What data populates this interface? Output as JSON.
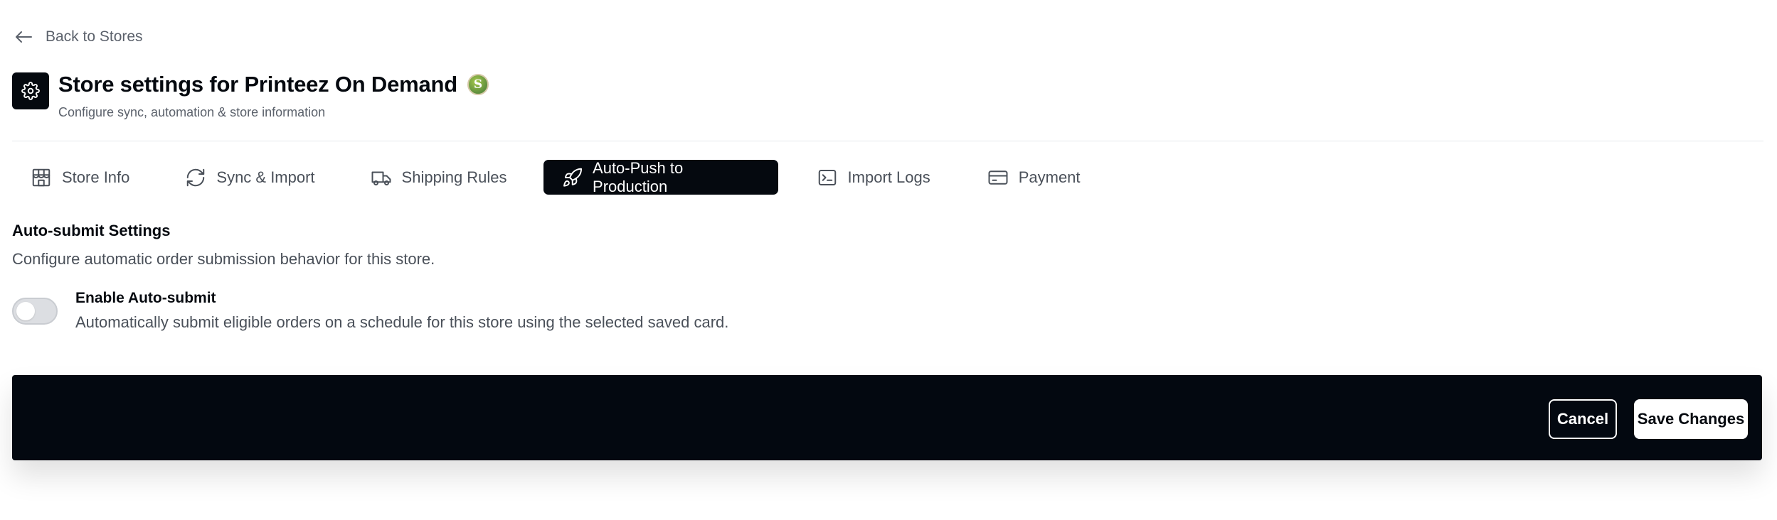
{
  "nav": {
    "back_label": "Back to Stores"
  },
  "header": {
    "title": "Store settings for Printeez On Demand",
    "subtitle": "Configure sync, automation & store information",
    "platform_icon": "shopify-icon",
    "platform_letter": "S"
  },
  "tabs": [
    {
      "label": "Store Info",
      "icon": "storefront-icon",
      "active": false
    },
    {
      "label": "Sync & Import",
      "icon": "refresh-icon",
      "active": false
    },
    {
      "label": "Shipping Rules",
      "icon": "truck-icon",
      "active": false
    },
    {
      "label": "Auto-Push to Production",
      "icon": "rocket-icon",
      "active": true
    },
    {
      "label": "Import Logs",
      "icon": "terminal-icon",
      "active": false
    },
    {
      "label": "Payment",
      "icon": "credit-card-icon",
      "active": false
    }
  ],
  "autosubmit": {
    "section_title": "Auto-submit Settings",
    "section_description": "Configure automatic order submission behavior for this store.",
    "toggle_label": "Enable Auto-submit",
    "toggle_description": "Automatically submit eligible orders on a schedule for this store using the selected saved card.",
    "enabled": false
  },
  "footer": {
    "cancel_label": "Cancel",
    "save_label": "Save Changes"
  },
  "colors": {
    "primary_dark": "#05090f",
    "muted_text": "#4a5059",
    "toggle_off": "#dcdee2"
  }
}
